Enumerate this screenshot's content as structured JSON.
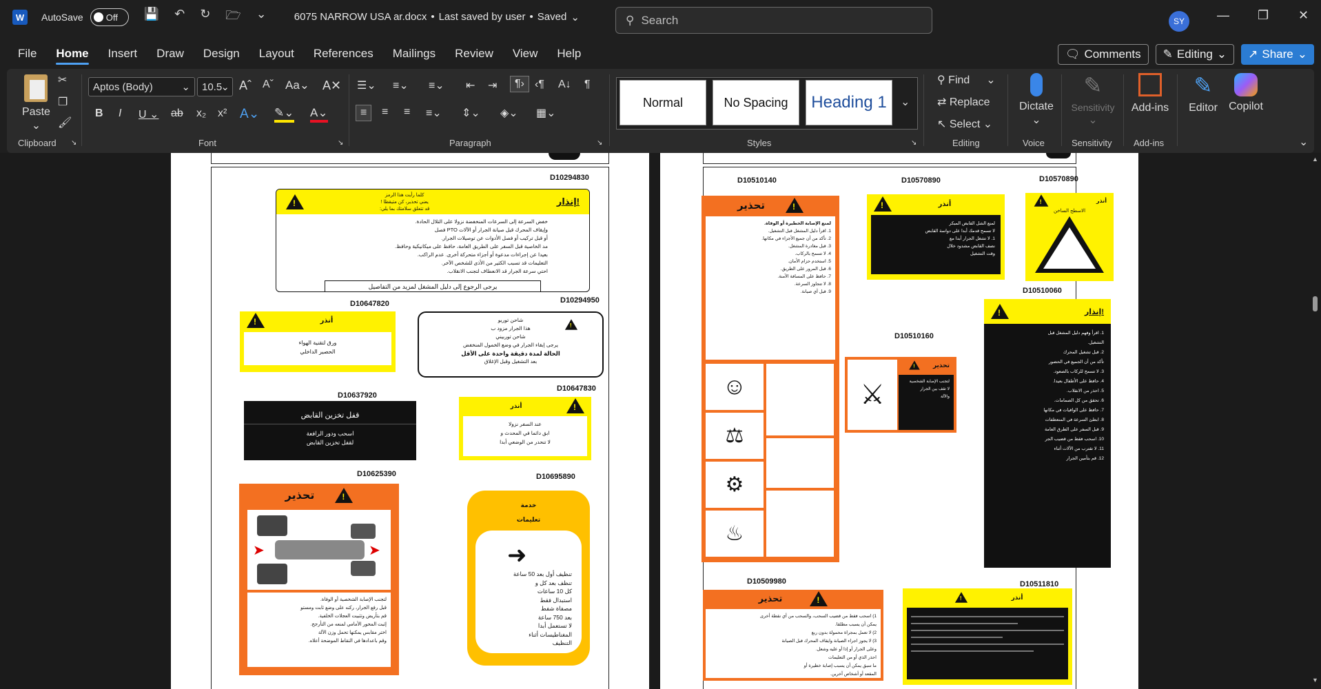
{
  "window": {
    "app_icon": "W",
    "autosave_label": "AutoSave",
    "autosave_state": "Off",
    "doc_title": "6075 NARROW USA  ar.docx",
    "save_status": "Last saved by user",
    "saved": "Saved",
    "search_placeholder": "Search",
    "avatar": "SY"
  },
  "menu": {
    "tabs": [
      "File",
      "Home",
      "Insert",
      "Draw",
      "Design",
      "Layout",
      "References",
      "Mailings",
      "Review",
      "View",
      "Help"
    ],
    "active": "Home",
    "comments": "Comments",
    "editing": "Editing",
    "share": "Share"
  },
  "ribbon": {
    "groups": {
      "clipboard": "Clipboard",
      "font": "Font",
      "paragraph": "Paragraph",
      "styles": "Styles",
      "editing": "Editing",
      "voice": "Voice",
      "sensitivity": "Sensitivity",
      "addins": "Add-ins"
    },
    "paste": "Paste",
    "font_name": "Aptos (Body)",
    "font_size": "10.5",
    "styles": [
      "Normal",
      "No Spacing",
      "Heading 1"
    ],
    "find": "Find",
    "replace": "Replace",
    "select": "Select",
    "dictate": "Dictate",
    "sensitivity": "Sensitivity",
    "addins": "Add-ins",
    "editor": "Editor",
    "copilot": "Copilot"
  },
  "left_page": {
    "codes": {
      "c1": "D10294830",
      "c2": "D10647820",
      "c3": "D10294950",
      "c4": "D10637920",
      "c5": "D10647830",
      "c6": "D10625390",
      "c7": "D10695890"
    },
    "d1_title": "إنذار!",
    "d1_top": [
      "كلما رأيت هذا الرمز",
      "يعني تحذير، كن متيقظا !",
      "قد تتعلق سلامتك بما يلي:"
    ],
    "d1_lines": [
      "خفض السرعة إلى السرعات المنخفضة نزولا على التلال الحادة.",
      "وإيقاف المحرك قبل صيانة الجرار أو الآلات PTO فصل",
      "أو قبل تركيب أو فصل الأدوات عن توصيلات الجرار.",
      "مد الخاصية قبل السفر على الطريق العامة، حافظ على ميكانيكية وحافظ.",
      "بعيدا عن إجراءات مدعوة أو أجزاء متحركة أخرى. عدم الراكب.",
      "التعليمات قد تسبب الكثير من الأذى للشخص الآخر.",
      "احتي سرعة الجرار قد الانعطاف لتجنب الانقلاب."
    ],
    "d1_footer": "يرجى الرجوع إلى دليل المشغل لمزيد من التفاصيل",
    "d2_title": "أنذر",
    "d2_lines": [
      "ورق لتقنية الهواء",
      "الحصير الداخلي"
    ],
    "d3_lines": [
      "شاحن توربو",
      "هذا الجرار مزود ب",
      "شاحن توربيني",
      "يرجى إبقاء الجرار في وضع الخمول المنخفض",
      "الحالة لمدة دقيقة واحدة على الأقل",
      "بعد التشغيل وقبل الإغلاق"
    ],
    "d4_title": "قفل تخزين القابض",
    "d4_lines": [
      "اسحب ودور الرافعة",
      "لقفل تخزين القابض"
    ],
    "d5_title": "أنذر",
    "d5_lines": [
      "عند السفر نزولا",
      "ابق دائما في المحدث و",
      "لا تنحدر من الوضعي أبدا"
    ],
    "d6_title": "تحذير",
    "d6_lines": [
      "لتجنب الإصابة الشخصية أو الوفاة.",
      "قبل رفع الجرار، ركنه على وضع ثابت ومستو",
      "قم بتأريض وتثبيت العجلات الخلفية.",
      "إثبت المحور الأمامي لمنعه من التأرجح.",
      "اختر مقابس يمكنها تحمل وزن الآلة",
      "وقم باعدادها في النقاط الموضحة أعلاه."
    ],
    "d7_title": "خدمة",
    "d7_sub": "تعليمات",
    "d7_lines": [
      "تنظيف أول بعد 50 ساعة",
      "تنظف بعد كل و",
      "كل 10 ساعات",
      "استبدال فقط",
      "مصفاة شفط",
      "بعد 750 ساعة",
      "لا تستعمل أبدا",
      "المغناطيسات أثناء",
      "التنظيف"
    ]
  },
  "right_page": {
    "codes": {
      "c1": "D10510140",
      "c2": "D10570890",
      "c3": "D10570890",
      "c4": "D10510060",
      "c5": "D10510160",
      "c6": "D10509980",
      "c7": "D10511810"
    },
    "r1_title": "تحذير",
    "r1_lines": [
      "لمنع الإصابة الخطيرة أو الوفاة.",
      "1. اقرأ دليل المشغل قبل التشغيل.",
      "2. تأكد من أن جميع الأجزاء في مكانها.",
      "3. قبل مغادرة المشغل.",
      "4. لا تسمح بالركاب.",
      "5. استخدم حزام الأمان.",
      "6. قبل المرور على الطريق.",
      "7. حافظ على المسافة الآمنة.",
      "8. لا تتجاوز السرعة.",
      "9. قبل أي صيانة."
    ],
    "r2_title": "أنذر",
    "r2_lines": [
      "لمنع الشل القابض المبكر",
      "لا تسمح قدمك أبدا على دواسة القابض",
      "1. لا تشغل الجرار أبدا مع",
      "نصف القابض مشدود خلال",
      "وقت التشغيل"
    ],
    "r3_title": "أنذر",
    "r3_sub": "الاسطح الساخن",
    "r4_title": "إنذار!",
    "r4_lines": [
      "1. اقرأ وفهم دليل المشغل قبل",
      "التشغيل.",
      "2. قبل تشغيل المحرك",
      "تأكد من أن الجميع في الحضور",
      "3. لا تسمح للركاب بالصعود.",
      "4. حافظ على الأطفال بعيدا.",
      "5. احذر من الانقلاب.",
      "6. تحقق من كل الصمامات.",
      "7. حافظ على الواقيات في مكانها",
      "8. ابطئ السرعة في المنعطفات",
      "9. قبل السفر على الطرق العامة",
      "10. اسحب فقط من قضيب الجر",
      "11. لا تقترب من الآلات أثناء",
      "12. قم بتأمين الجرار"
    ],
    "r5_title": "تحذير",
    "r5_lines": [
      "لتجنب الإصابة الشخصية",
      "لا تقف بين الجرار",
      "والآلة"
    ],
    "r6_title": "تحذير",
    "r6_lines": [
      "1) اسحب فقط من قضيب السحب، والسحب من أي نقطة أخرى",
      "يمكن أن يسبب مطلقا.",
      "2) لا تعمل بمجراة محمولة بدون ربع",
      "3) لا يجوز اجراء الصيانة وايقاف المحرك قبل الصيانة",
      "وعلى الجرار أو إذا أو عليه وشعل.",
      "احذر الذي أو من التعليمات",
      "ما سبق يمكن أن يسبب إصابة خطيرة أو",
      "المقعد أو أشخاص آخرين."
    ],
    "r7_title": "أنذر"
  }
}
